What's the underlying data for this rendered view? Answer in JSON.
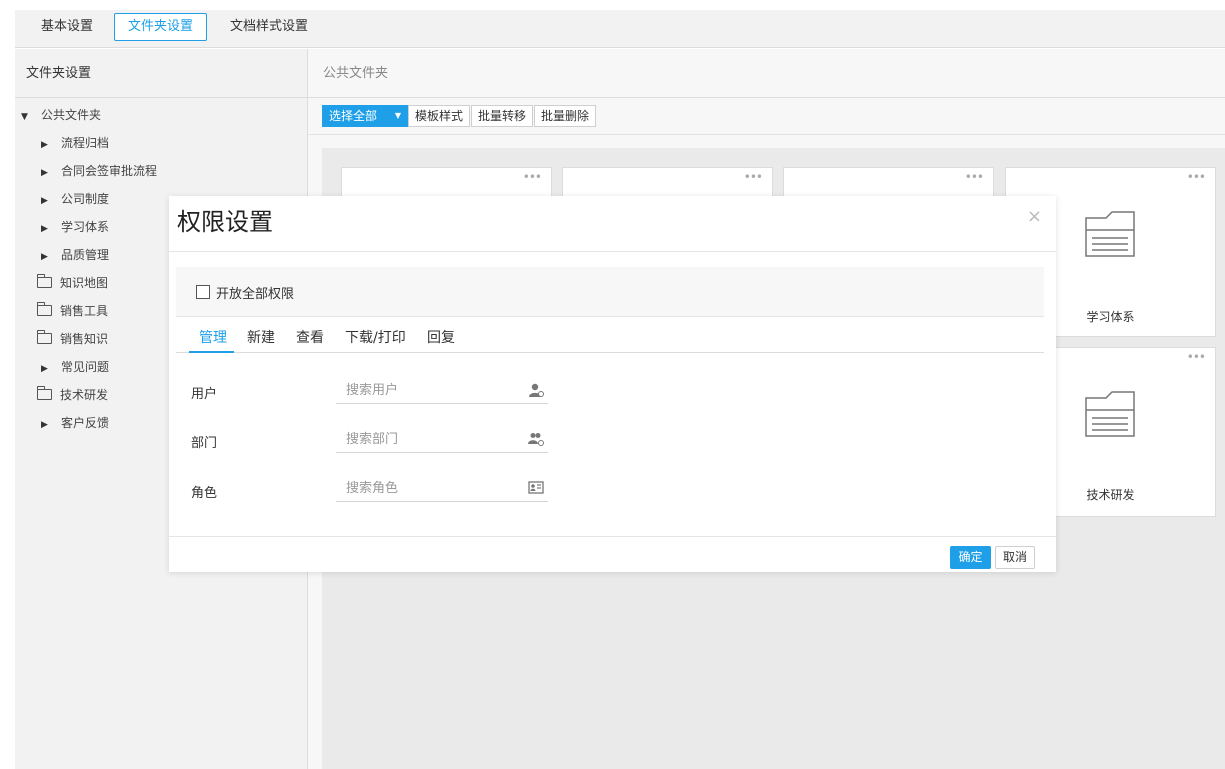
{
  "top_tabs": [
    {
      "label": "基本设置",
      "active": false
    },
    {
      "label": "文件夹设置",
      "active": true
    },
    {
      "label": "文档样式设置",
      "active": false
    }
  ],
  "left_panel": {
    "title": "文件夹设置",
    "tree": [
      {
        "label": "公共文件夹",
        "type": "expanded"
      },
      {
        "label": "流程归档",
        "type": "collapsed"
      },
      {
        "label": "合同会签审批流程",
        "type": "collapsed"
      },
      {
        "label": "公司制度",
        "type": "collapsed"
      },
      {
        "label": "学习体系",
        "type": "collapsed"
      },
      {
        "label": "品质管理",
        "type": "collapsed"
      },
      {
        "label": "知识地图",
        "type": "folder"
      },
      {
        "label": "销售工具",
        "type": "folder"
      },
      {
        "label": "销售知识",
        "type": "folder"
      },
      {
        "label": "常见问题",
        "type": "collapsed"
      },
      {
        "label": "技术研发",
        "type": "folder"
      },
      {
        "label": "客户反馈",
        "type": "collapsed"
      }
    ]
  },
  "right_panel": {
    "breadcrumb": "公共文件夹",
    "toolbar": {
      "select_all": "选择全部",
      "template_style": "模板样式",
      "batch_move": "批量转移",
      "batch_delete": "批量删除"
    },
    "cards": [
      {
        "label": ""
      },
      {
        "label": ""
      },
      {
        "label": ""
      },
      {
        "label": "学习体系"
      },
      {
        "label": "技术研发"
      }
    ],
    "more_glyph": "•••"
  },
  "modal": {
    "title": "权限设置",
    "close_glyph": "×",
    "open_all_label": "开放全部权限",
    "tabs": [
      "管理",
      "新建",
      "查看",
      "下载/打印",
      "回复"
    ],
    "active_tab": "管理",
    "fields": {
      "user": {
        "label": "用户",
        "placeholder": "搜索用户",
        "icon": "user-icon"
      },
      "department": {
        "label": "部门",
        "placeholder": "搜索部门",
        "icon": "group-icon"
      },
      "role": {
        "label": "角色",
        "placeholder": "搜索角色",
        "icon": "id-card-icon"
      }
    },
    "ok_label": "确定",
    "cancel_label": "取消"
  },
  "colors": {
    "accent": "#1e9fe8",
    "panel_bg": "#f2f2f2",
    "content_bg": "#eaeaea"
  }
}
